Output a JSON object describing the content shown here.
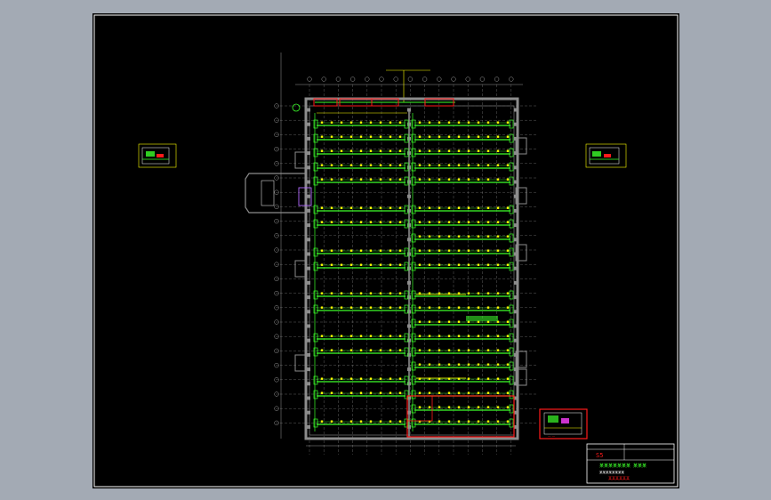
{
  "colors": {
    "background": "#a3aab4",
    "viewport": "#000000",
    "frame": "#ffffff",
    "wall": "#8c8c8c",
    "grid": "#bfbfbf",
    "pipe_green": "#3cff2a",
    "pipe_yellow": "#ffff00",
    "highlight_red": "#ff1a1a",
    "detail_magenta": "#ff40ff"
  },
  "drawing": {
    "title_block": {
      "sheet_no": "S5",
      "line1": "某某某某某某某 某某某",
      "line2": "某某某某某某某某",
      "line3": "某某某某某某"
    }
  }
}
